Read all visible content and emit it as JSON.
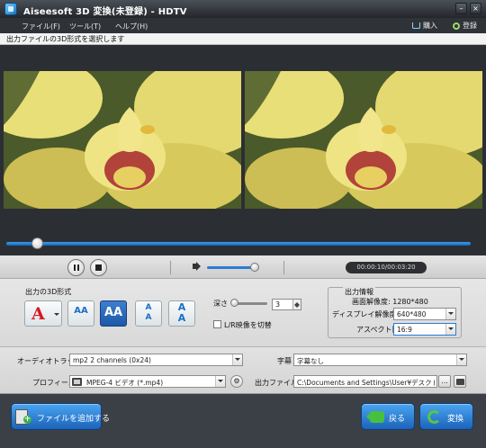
{
  "window": {
    "title": "Aiseesoft 3D 変換(未登録) - HDTV",
    "minimize_glyph": "–",
    "close_glyph": "×"
  },
  "menu": {
    "file": "ファイル(F)",
    "tools": "ツール(T)",
    "help": "ヘルプ(H)",
    "purchase": "購入",
    "register": "登録"
  },
  "instruction": "出力ファイルの3D形式を選択します",
  "player": {
    "time": "00:00:10/00:03:20",
    "seek_fraction": 0.07,
    "volume_fraction": 0.85
  },
  "settings": {
    "format_label": "出力の3D形式",
    "formats": [
      {
        "icon": "anaglyph-icon",
        "label": "A"
      },
      {
        "icon": "side-by-side-half-icon",
        "label": "AA"
      },
      {
        "icon": "side-by-side-full-icon",
        "label": "AA"
      },
      {
        "icon": "top-bottom-half-icon",
        "label": "A"
      },
      {
        "icon": "top-bottom-full-icon",
        "label": "A"
      }
    ],
    "depth_label": "深さ",
    "depth_value": "3",
    "swap_label": "L/R映像を切替",
    "output_info_title": "出力情報",
    "resolution_text": "画面解像度: 1280*480",
    "display_res_label": "ディスプレイ解像度:",
    "display_res_value": "640*480",
    "aspect_label": "アスペクト比:",
    "aspect_value": "16:9"
  },
  "bottom": {
    "audio_label": "オーディオトラック",
    "audio_value": "mp2 2 channels (0x24)",
    "subtitle_label": "字幕",
    "subtitle_value": "字幕なし",
    "profile_label": "プロフィール",
    "profile_value": "MPEG-4 ビデオ (*.mp4)",
    "output_label": "出力ファイル",
    "output_value": "C:\\Documents and Settings\\User¥デスクトップ",
    "browse_label": "..."
  },
  "footer": {
    "add_file": "ファイルを追加する",
    "back": "戻る",
    "convert": "変換"
  },
  "colors": {
    "accent": "#2d7bd0",
    "anaglyph_red": "#d71920",
    "confirm_green": "#47c03f"
  }
}
